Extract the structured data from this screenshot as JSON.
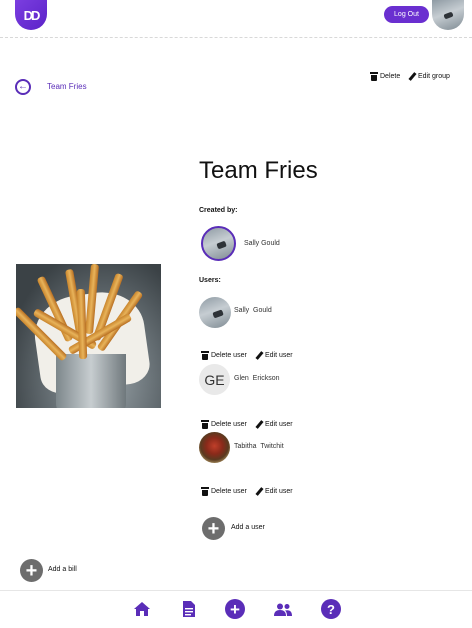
{
  "header": {
    "logo_text": "DD",
    "logout_label": "Log Out",
    "avatar_icon": "user-avatar"
  },
  "nav": {
    "breadcrumb": "Team Fries",
    "back_icon": "arrow-left-circle-icon"
  },
  "group_actions": {
    "delete_label": "Delete",
    "edit_label": "Edit group"
  },
  "group": {
    "title": "Team Fries",
    "created_by_label": "Created by:",
    "creator_name": "Sally Gould",
    "users_label": "Users:",
    "users": [
      {
        "name": "Sally  Gould",
        "avatar": "photo"
      },
      {
        "name": "Glen  Erickson",
        "avatar": "initials",
        "initials": "GE"
      },
      {
        "name": "Tabitha  Twitchit",
        "avatar": "photo"
      }
    ],
    "delete_user_label": "Delete user",
    "edit_user_label": "Edit user",
    "add_user_label": "Add a user",
    "add_bill_label": "Add a bill"
  },
  "bottom_nav": {
    "items": [
      "home-icon",
      "document-icon",
      "add-icon",
      "users-icon",
      "help-icon"
    ],
    "plus_symbol": "+",
    "help_symbol": "?"
  },
  "colors": {
    "accent": "#5a2db8",
    "button": "#6a2fd0",
    "add_button": "#6d6d6d"
  }
}
